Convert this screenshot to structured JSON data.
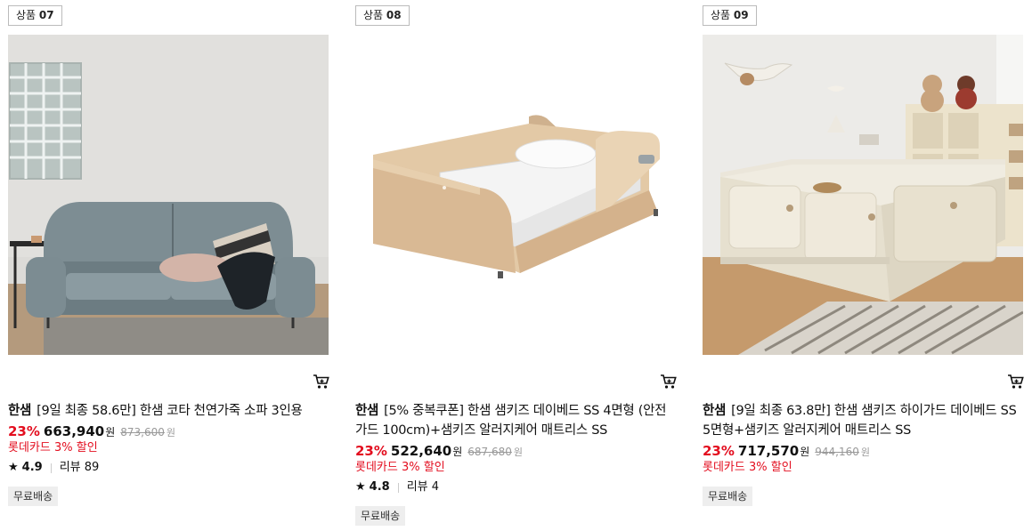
{
  "products": [
    {
      "badge_prefix": "상품",
      "badge_num": "07",
      "brand": "한샘",
      "name": "[9일 최종 58.6만] 한샘 코타 천연가죽 소파 3인용",
      "discount_rate": "23%",
      "price": "663,940",
      "currency": "원",
      "original_price": "873,600",
      "card_discount": "롯데카드 3% 할인",
      "rating": "4.9",
      "review_label": "리뷰 89",
      "shipping": "무료배송",
      "image": "sofa-image"
    },
    {
      "badge_prefix": "상품",
      "badge_num": "08",
      "brand": "한샘",
      "name": "[5% 중복쿠폰] 한샘 샘키즈 데이베드 SS 4면형 (안전가드 100cm)+샘키즈 알러지케어 매트리스 SS",
      "discount_rate": "23%",
      "price": "522,640",
      "currency": "원",
      "original_price": "687,680",
      "card_discount": "롯데카드 3% 할인",
      "rating": "4.8",
      "review_label": "리뷰 4",
      "shipping": "무료배송",
      "image": "daybed-image"
    },
    {
      "badge_prefix": "상품",
      "badge_num": "09",
      "brand": "한샘",
      "name": "[9일 최종 63.8만] 한샘 샘키즈 하이가드 데이베드 SS 5면형+샘키즈 알러지케어 매트리스 SS",
      "discount_rate": "23%",
      "price": "717,570",
      "currency": "원",
      "original_price": "944,160",
      "card_discount": "롯데카드 3% 할인",
      "shipping": "무료배송",
      "image": "kids-bed-image"
    }
  ],
  "colors": {
    "discount": "#e30e1f",
    "text": "#111111",
    "muted": "#999999",
    "tag_bg": "#eeeeee"
  },
  "icons": {
    "cart": "cart-icon",
    "star": "star-icon"
  }
}
